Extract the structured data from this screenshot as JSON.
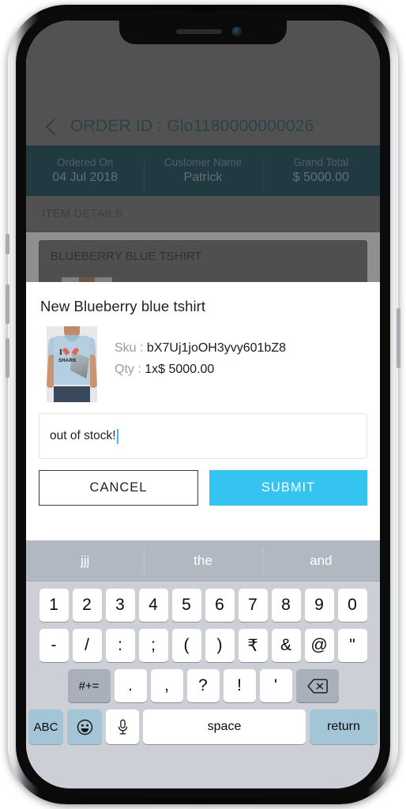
{
  "app": {
    "header": {
      "back_icon": "back-chevron-icon",
      "order_id_label": "ORDER ID : Glo1180000000026"
    },
    "summary": [
      {
        "label": "Ordered On",
        "value": "04 Jul 2018"
      },
      {
        "label": "Customer Name",
        "value": "Patrick"
      },
      {
        "label": "Grand Total",
        "value": "$ 5000.00"
      }
    ],
    "section_title": "ITEM DETAILS",
    "item_card": {
      "title": "BLUEBERRY BLUE TSHIRT"
    }
  },
  "modal": {
    "title": "New Blueberry blue tshirt",
    "thumbnail_alt": "blue-tshirt-thumbnail",
    "sku_label": "Sku :",
    "sku_value": "bX7Uj1joOH3yvy601bZ8",
    "qty_label": "Qty :",
    "qty_value": "1x$ 5000.00",
    "note_value": "out of stock!",
    "note_placeholder": "",
    "cancel_label": "CANCEL",
    "submit_label": "SUBMIT"
  },
  "keyboard": {
    "suggestions": [
      "jjj",
      "the",
      "and"
    ],
    "row1": [
      "1",
      "2",
      "3",
      "4",
      "5",
      "6",
      "7",
      "8",
      "9",
      "0"
    ],
    "row2": [
      "-",
      "/",
      ":",
      ";",
      "(",
      ")",
      "₹",
      "&",
      "@",
      "\""
    ],
    "row3_shift": "#+=",
    "row3": [
      ".",
      ",",
      "?",
      "!",
      "'"
    ],
    "row3_backspace_icon": "backspace-icon",
    "row4_abc": "ABC",
    "row4_emoji_icon": "emoji-icon",
    "row4_mic_icon": "microphone-icon",
    "row4_space": "space",
    "row4_return": "return"
  },
  "colors": {
    "teal_band": "#1a4b5d",
    "teal_text": "#2d5e6b",
    "submit_blue": "#35c3ef",
    "caret_blue": "#39c2ef",
    "keyboard_bg": "#ccd0d6",
    "key_blue": "#a3c5d6"
  }
}
